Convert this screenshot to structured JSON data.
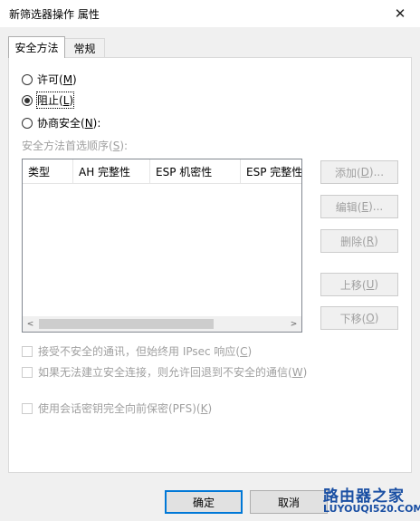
{
  "window": {
    "title": "新筛选器操作 属性",
    "close_glyph": "✕"
  },
  "tabs": [
    {
      "label": "安全方法",
      "active": true
    },
    {
      "label": "常规",
      "active": false
    }
  ],
  "options": {
    "permit": {
      "text": "许可(",
      "key": "M",
      "tail": ")"
    },
    "block": {
      "text": "阻止(",
      "key": "L",
      "tail": ")"
    },
    "negotiate": {
      "text": "协商安全(",
      "key": "N",
      "tail": "):"
    }
  },
  "methods": {
    "label_text": "安全方法首选顺序(",
    "label_key": "S",
    "label_tail": "):",
    "columns": [
      "类型",
      "AH 完整性",
      "ESP 机密性",
      "ESP 完整性"
    ],
    "scroll_left": "<",
    "scroll_right": ">"
  },
  "side_buttons": {
    "add": {
      "text": "添加(",
      "key": "D",
      "tail": ")..."
    },
    "edit": {
      "text": "编辑(",
      "key": "E",
      "tail": ")..."
    },
    "remove": {
      "text": "删除(",
      "key": "R",
      "tail": ")"
    },
    "move_up": {
      "text": "上移(",
      "key": "U",
      "tail": ")"
    },
    "move_down": {
      "text": "下移(",
      "key": "O",
      "tail": ")"
    }
  },
  "checkboxes": {
    "accept_unsecured": {
      "text": "接受不安全的通讯，但始终用 IPsec 响应(",
      "key": "C",
      "tail": ")"
    },
    "allow_fallback": {
      "text": "如果无法建立安全连接，则允许回退到不安全的通信(",
      "key": "W",
      "tail": ")"
    },
    "pfs": {
      "text": "使用会话密钥完全向前保密(PFS)(",
      "key": "K",
      "tail": ")"
    }
  },
  "footer": {
    "ok": "确定",
    "cancel": "取消"
  },
  "watermark": {
    "line1": "路由器之家",
    "line2": "LUYOUQI520.COM"
  }
}
